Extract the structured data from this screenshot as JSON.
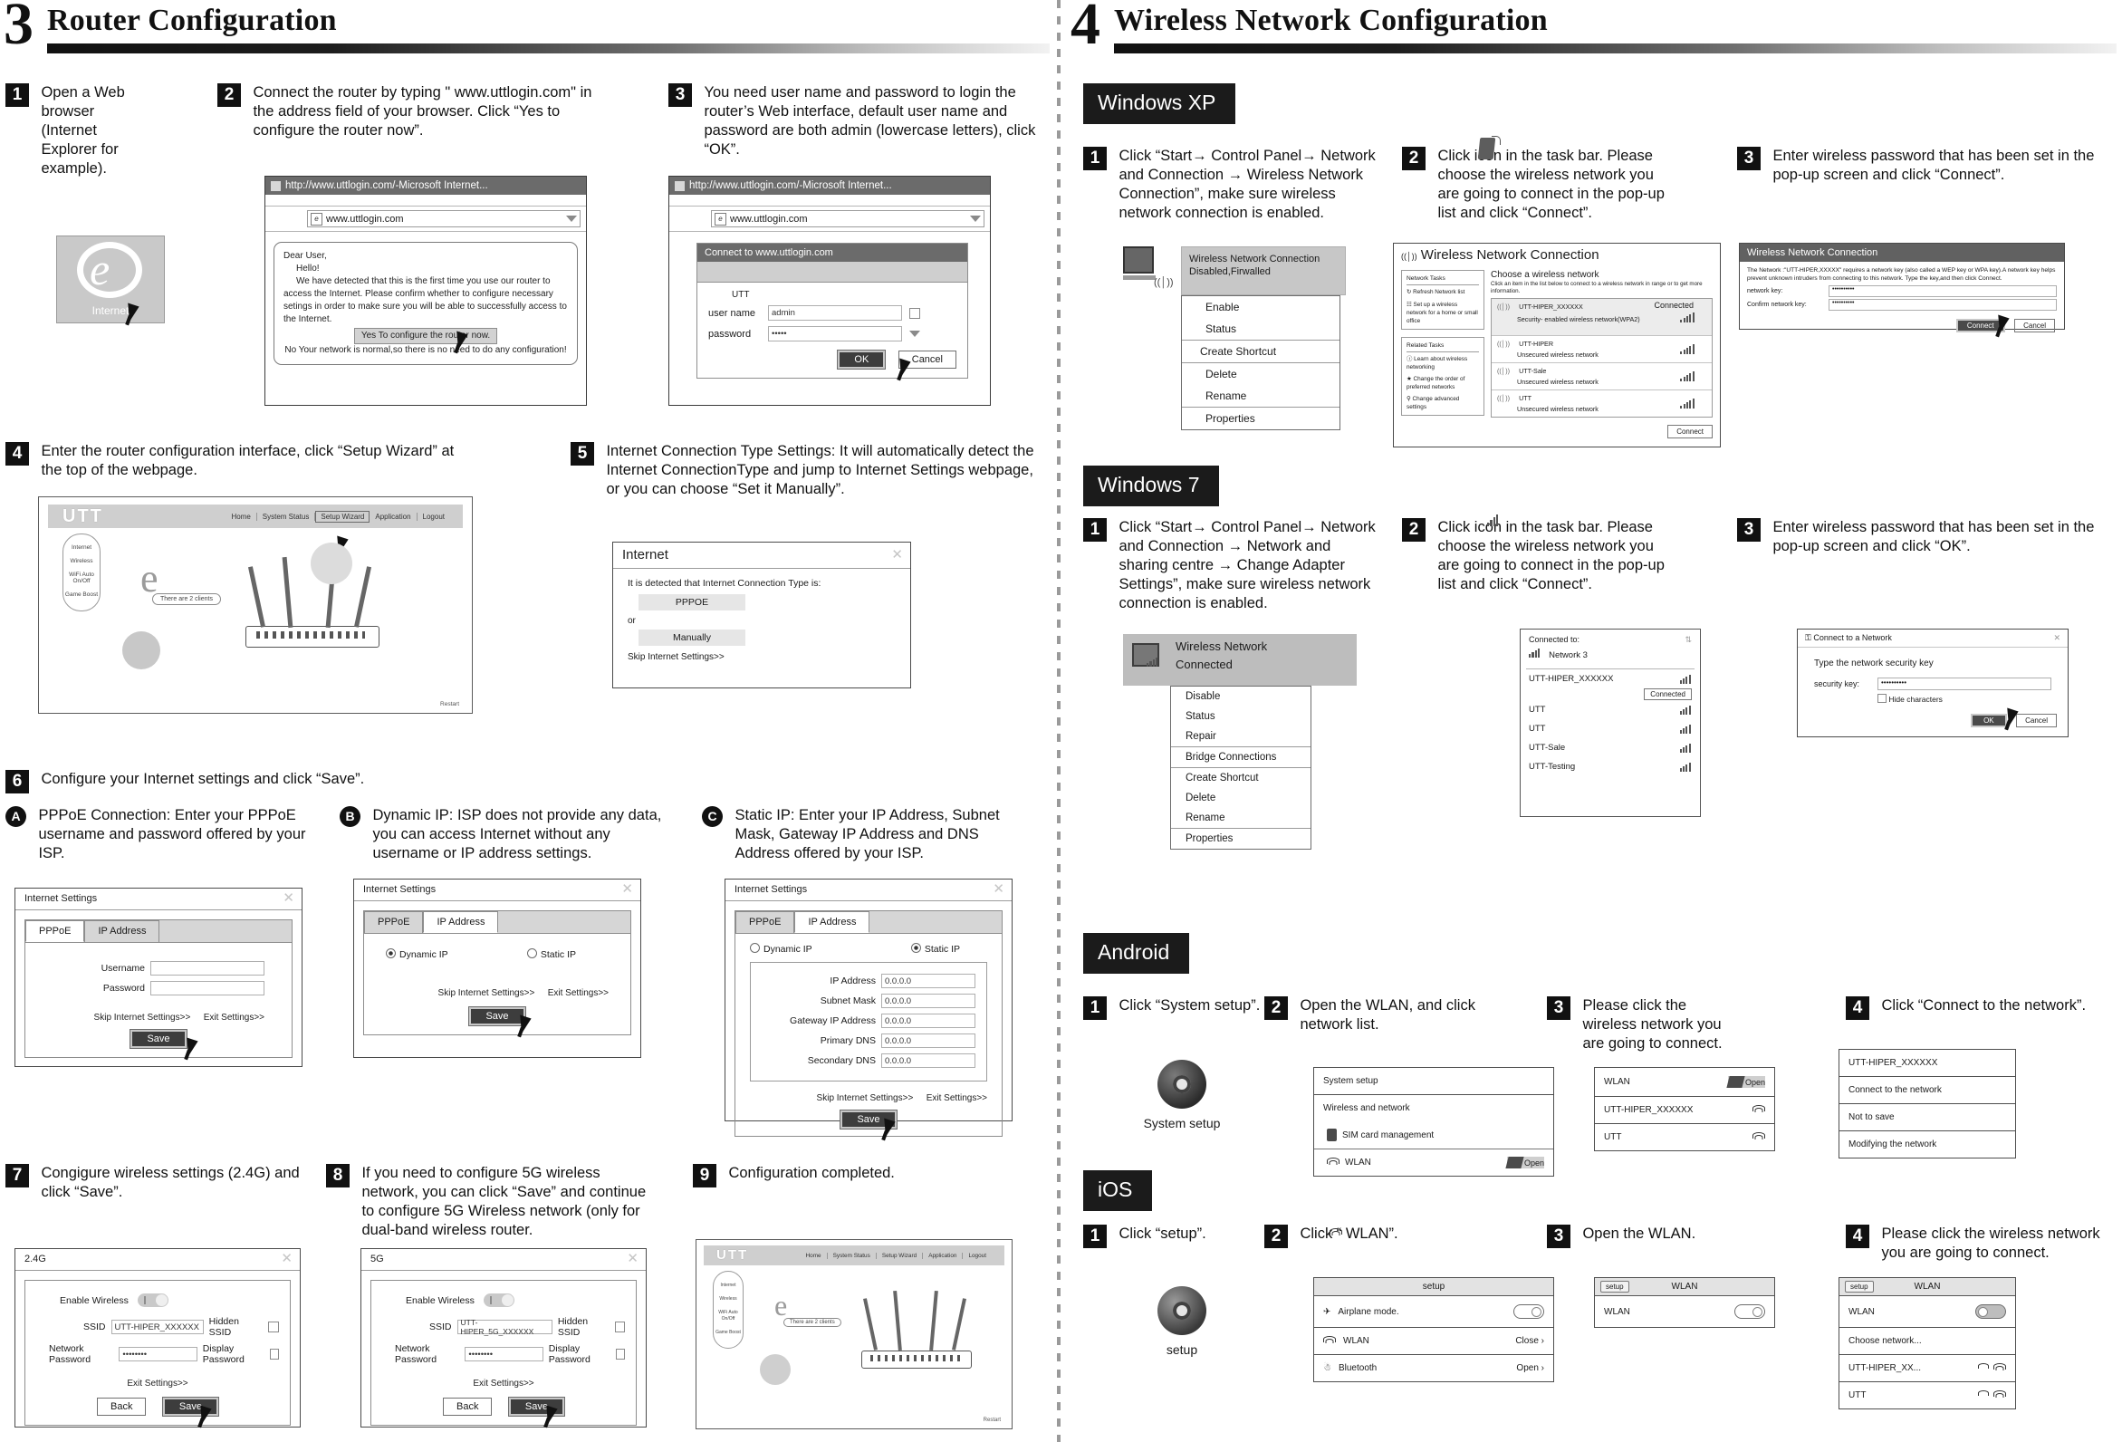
{
  "left": {
    "section": {
      "number": "3",
      "title": "Router Configuration"
    },
    "steps": {
      "s1": "Open a Web browser (Internet Explorer for example).",
      "s2": "Connect the router by typing \" www.uttlogin.com\" in the address field of your browser. Click “Yes to configure the router now”.",
      "s3": "You need user name and password to login the router’s Web interface, default user name and password are both admin (lowercase letters), click “OK”.",
      "s4": "Enter the router configuration interface, click “Setup Wizard” at the top of the webpage.",
      "s5": "Internet Connection Type Settings: It will automatically detect the Internet ConnectionType and jump to Internet Settings webpage, or you can choose “Set it Manually”.",
      "s6": "Configure your Internet settings and click “Save”.",
      "s7": "Congigure wireless settings (2.4G) and click “Save”.",
      "s8": "If you need to configure 5G wireless network, you can click “Save” and continue to configure 5G Wireless network (only for dual-band wireless router.",
      "s9": "Configuration completed."
    },
    "ie_icon_label": "Internet",
    "browser1": {
      "title": "http://www.uttlogin.com/-Microsoft Internet...",
      "address": "www.uttlogin.com",
      "note_line1": "Dear User,",
      "note_line2": "Hello!",
      "note_line3": "We have detected that this is the first time you use our router to access the Internet. Please confirm whether to configure necessary setings in order to make sure you will be able to successfully access to the Internet.",
      "yes_button": "Yes To configure the router  now.",
      "note_line4": "No Your network is normal,so there is no need to do any configuration!"
    },
    "browser2": {
      "title": "http://www.uttlogin.com/-Microsoft Internet...",
      "address": "www.uttlogin.com",
      "dialog_title": "Connect to  www.uttlogin.com",
      "brand": "UTT",
      "user_label": "user name",
      "user_value": "admin",
      "pass_label": "password",
      "pass_value": "•••••",
      "ok": "OK",
      "cancel": "Cancel"
    },
    "router_ui": {
      "logo": "UTT",
      "nav": [
        "Home",
        "System Status",
        "Setup Wizard",
        "Application",
        "Logout"
      ],
      "client_bubble": "There are 2 clients",
      "side_items": [
        "Internet",
        "Wireless",
        "WiFi Auto On/Off",
        "Game Boost"
      ],
      "restart_label": "Restart"
    },
    "internet_dialog": {
      "title": "Internet",
      "detect_text": "It is detected that Internet Connection Type is:",
      "type_value": "PPPOE",
      "or": "or",
      "manual": "Manually",
      "skip": "Skip Internet Settings>>"
    },
    "options": {
      "a_letter": "A",
      "a_text": "PPPoE Connection: Enter your PPPoE username and password offered by your ISP.",
      "b_letter": "B",
      "b_text": "Dynamic IP: ISP does not provide any data, you can access Internet without any username or IP address settings.",
      "c_letter": "C",
      "c_text": "Static IP: Enter your IP Address, Subnet Mask, Gateway IP Address and DNS Address offered by your ISP."
    },
    "settings_a": {
      "title": "Internet Settings",
      "tab1": "PPPoE",
      "tab2": "IP Address",
      "username_label": "Username",
      "password_label": "Password",
      "skip": "Skip Internet Settings>>",
      "exit": "Exit Settings>>",
      "save": "Save"
    },
    "settings_b": {
      "title": "Internet Settings",
      "tab1": "PPPoE",
      "tab2": "IP Address",
      "dynamic": "Dynamic IP",
      "static": "Static IP",
      "skip": "Skip Internet Settings>>",
      "exit": "Exit Settings>>",
      "save": "Save"
    },
    "settings_c": {
      "title": "Internet Settings",
      "tab1": "PPPoE",
      "tab2": "IP Address",
      "dynamic": "Dynamic IP",
      "static": "Static IP",
      "fields": [
        {
          "label": "IP Address",
          "value": "0.0.0.0"
        },
        {
          "label": "Subnet Mask",
          "value": "0.0.0.0"
        },
        {
          "label": "Gateway IP Address",
          "value": "0.0.0.0"
        },
        {
          "label": "Primary DNS",
          "value": "0.0.0.0"
        },
        {
          "label": "Secondary DNS",
          "value": "0.0.0.0"
        }
      ],
      "skip": "Skip Internet Settings>>",
      "exit": "Exit Settings>>",
      "save": "Save"
    },
    "wireless_24": {
      "title": "2.4G",
      "enable_label": "Enable Wireless",
      "ssid_label": "SSID",
      "ssid_value": "UTT-HIPER_XXXXXX",
      "hidden_label": "Hidden SSID",
      "pass_label": "Network Password",
      "pass_value": "••••••••",
      "display_label": "Display Password",
      "exit": "Exit Settings>>",
      "back": "Back",
      "save": "Save"
    },
    "wireless_5g": {
      "title": "5G",
      "enable_label": "Enable Wireless",
      "ssid_label": "SSID",
      "ssid_value": "UTT-HIPER_5G_XXXXXX",
      "hidden_label": "Hidden SSID",
      "pass_label": "Network Password",
      "pass_value": "••••••••",
      "display_label": "Display Password",
      "exit": "Exit Settings>>",
      "back": "Back",
      "save": "Save"
    }
  },
  "right": {
    "section": {
      "number": "4",
      "title": "Wireless Network Configuration"
    },
    "winxp": {
      "tag": "Windows XP",
      "s1": "Click “Start→ Control Panel→ Network and Connection → Wireless Network Connection”, make sure wireless network connection is enabled.",
      "s2": "Click icon       in the task bar. Please choose the wireless network you are going to connect in the pop-up list and click “Connect”.",
      "s3": "Enter wireless password that has been set in the pop-up screen and click “Connect”.",
      "menu": {
        "header1": "Wireless Network Connection",
        "header2": "Disabled,Firwalled",
        "items": [
          "Enable",
          "Status",
          "Create Shortcut",
          "Delete",
          "Rename",
          "Properties"
        ]
      },
      "window": {
        "title": "Wireless Network Connection",
        "tasks_title": "Network Tasks",
        "tasks": [
          "Refresh Network list",
          "Set up a wireless network for a home or small office"
        ],
        "related_title": "Related Tasks",
        "related": [
          "Learn about wireless networking",
          "Change the order of preferred networks",
          "Change advanced settings"
        ],
        "choose_title": "Choose a wireless network",
        "choose_sub": "Click an item in the list below to connect to a wireless network in range or to get more information.",
        "networks": [
          {
            "ssid": "UTT-HIPER_XXXXXX",
            "sub": "Security- enabled wireless network(WPA2)",
            "status": "Connected"
          },
          {
            "ssid": "UTT-HIPER",
            "sub": "Unsecured wireless network",
            "status": ""
          },
          {
            "ssid": "UTT-Sale",
            "sub": "Unsecured wireless network",
            "status": ""
          },
          {
            "ssid": "UTT",
            "sub": "Unsecured wireless network",
            "status": ""
          }
        ],
        "connect": "Connect"
      },
      "key_dialog": {
        "title": "Wireless Network Connection",
        "body": "The Network :\"UTT-HIPER,XXXXX\" requires a network key (also called a WEP key or  WPA key).A network key helps prevent unknown intruders from connecting to this network. Type the key,and then click Connect.",
        "key_label": "network key:",
        "key_value": "••••••••••",
        "confirm_label": "Confirm network key:",
        "confirm_value": "••••••••••",
        "connect": "Connect",
        "cancel": "Cancel"
      }
    },
    "win7": {
      "tag": "Windows 7",
      "s1": "Click “Start→ Control Panel→ Network and Connection → Network and sharing centre → Change Adapter Settings”, make sure wireless network connection is enabled.",
      "s2": "Click icon        in the task bar. Please choose the wireless network you are going to connect in the pop-up list and click “Connect”.",
      "s3": "Enter wireless password that has been set in the pop-up screen and click “OK”.",
      "menu": {
        "header1": "Wireless Network",
        "header2": "Connected",
        "items": [
          "Disable",
          "Status",
          "Repair",
          "Bridge Connections",
          "Create Shortcut",
          "Delete",
          "Rename",
          "Properties"
        ]
      },
      "panel": {
        "connected_to": "Connected to:",
        "current": "Network 3",
        "selected": "UTT-HIPER_XXXXXX",
        "connected_btn": "Connected",
        "networks": [
          "UTT",
          "UTT",
          "UTT-Sale",
          "UTT-Testing"
        ]
      },
      "key_dialog": {
        "title": "Connect to a Network",
        "prompt": "Type the network security key",
        "key_label": "security key:",
        "key_value": "••••••••••",
        "hide_label": "Hide characters",
        "ok": "OK",
        "cancel": "Cancel"
      }
    },
    "android": {
      "tag": "Android",
      "s1": "Click “System setup”.",
      "s2": "Open the WLAN, and click network list.",
      "s3": "Please click the wireless network you are going to connect.",
      "s4": "Click “Connect to the network”.",
      "icon_label": "System setup",
      "card1": [
        "System setup",
        "Wireless and network",
        "SIM card management",
        "WLAN"
      ],
      "card1_open": "Open",
      "card2_title": "WLAN",
      "card2_open": "Open",
      "card2_items": [
        "UTT-HIPER_XXXXXX",
        "UTT"
      ],
      "card3_items": [
        "UTT-HIPER_XXXXXX",
        "Connect to the network",
        "Not to save",
        "Modifying the network"
      ]
    },
    "ios": {
      "tag": "iOS",
      "s1": "Click “setup”.",
      "s2": "Click “     WLAN”.",
      "s3": "Open the WLAN.",
      "s4": "Please click the wireless network you are going to connect.",
      "icon_label": "setup",
      "card1_title": "setup",
      "card1_items": [
        {
          "label": "Airplane mode.",
          "right": ""
        },
        {
          "label": "WLAN",
          "right": "Close"
        },
        {
          "label": "Bluetooth",
          "right": "Open"
        }
      ],
      "card2_back": "setup",
      "card2_title": "WLAN",
      "card2_item": "WLAN",
      "card3_back": "setup",
      "card3_title": "WLAN",
      "card3_item": "WLAN",
      "card3_choose": "Choose network...",
      "card3_items": [
        "UTT-HIPER_XX...",
        "UTT"
      ]
    }
  }
}
